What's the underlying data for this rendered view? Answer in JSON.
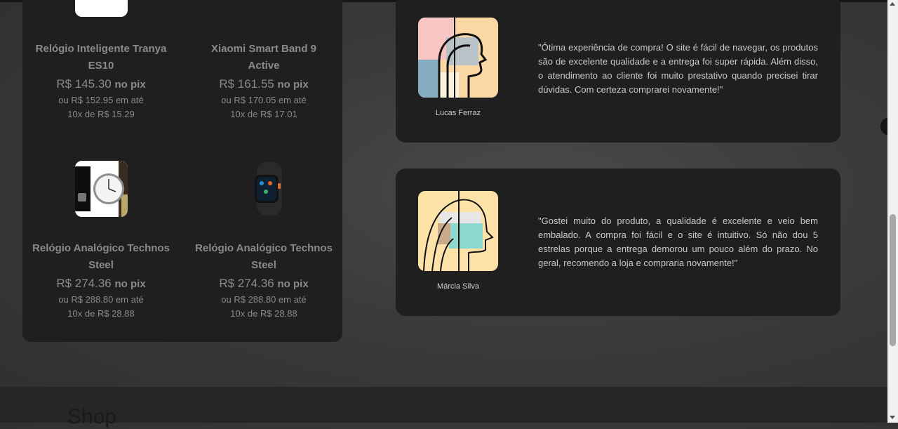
{
  "products": [
    {
      "name": "Relógio Inteligente Tranya ES10",
      "price": "R$ 145.30",
      "pix_label": "no pix",
      "installment_line1": "ou R$ 152.95 em até",
      "installment_line2": "10x de R$ 15.29",
      "image": "smartwatch-image"
    },
    {
      "name": "Xiaomi Smart Band 9 Active",
      "price": "R$ 161.55",
      "pix_label": "no pix",
      "installment_line1": "ou R$ 170.05 em até",
      "installment_line2": "10x de R$ 17.01",
      "image": "smartband-image"
    },
    {
      "name": "Relógio Analógico Technos Steel",
      "price": "R$ 274.36",
      "pix_label": "no pix",
      "installment_line1": "ou R$ 288.80 em até",
      "installment_line2": "10x de R$ 28.88",
      "image": "analog-watch-image"
    },
    {
      "name": "Relógio Analógico Technos Steel",
      "price": "R$ 274.36",
      "pix_label": "no pix",
      "installment_line1": "ou R$ 288.80 em até",
      "installment_line2": "10x de R$ 28.88",
      "image": "smartwatch-black-image"
    }
  ],
  "testimonials": [
    {
      "author": "Lucas Ferraz",
      "quote": "\"Ótima experiência de compra! O site é fácil de navegar, os produtos são de excelente qualidade e a entrega foi super rápida. Além disso, o atendimento ao cliente foi muito prestativo quando precisei tirar dúvidas. Com certeza comprarei novamente!\""
    },
    {
      "author": "Márcia Silva",
      "quote": "\"Gostei muito do produto, a qualidade é excelente e veio bem embalado. A compra foi fácil e o site é intuitivo. Só não dou 5 estrelas porque a entrega demorou um pouco além do prazo. No geral, recomendo a loja e compraria novamente!\""
    }
  ],
  "footer": {
    "title": "Shop"
  },
  "colors": {
    "panel": "#1f1f1f",
    "muted_text": "#8a8a8a",
    "background": "#3a3a3a"
  }
}
